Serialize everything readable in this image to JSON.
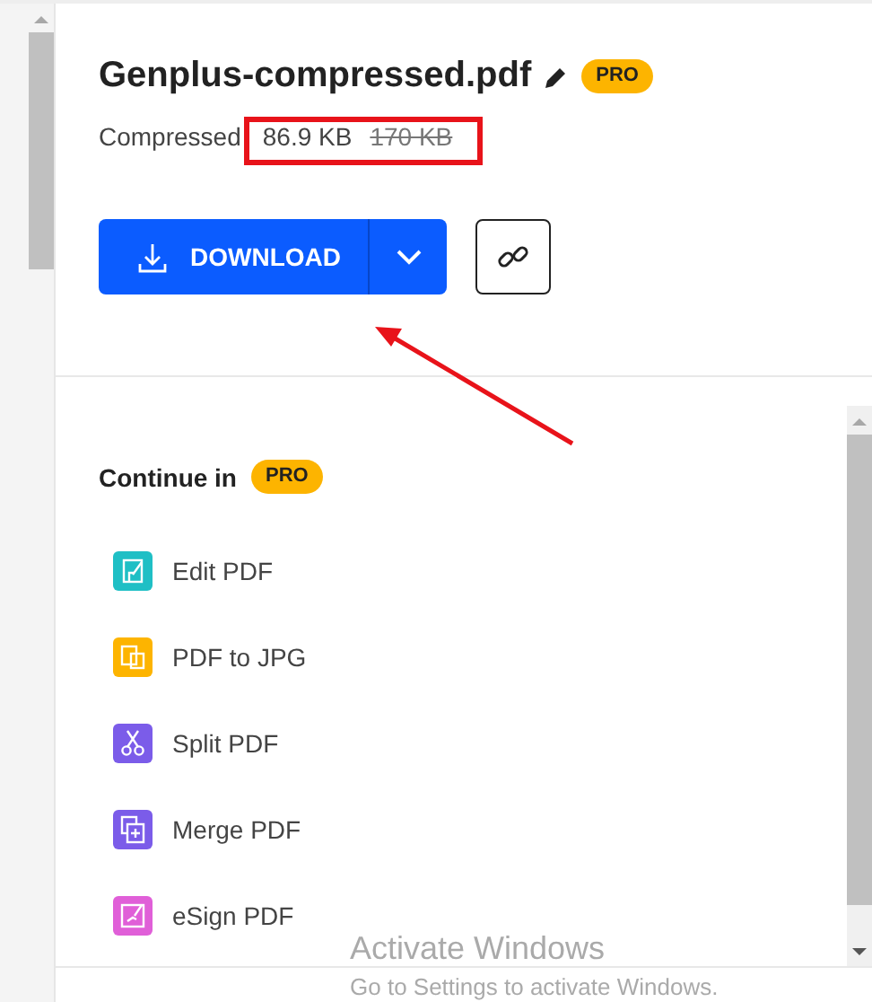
{
  "file": {
    "name": "Genplus-compressed.pdf",
    "badge": "PRO",
    "size_label": "Compressed",
    "new_size": "86.9 KB",
    "old_size": "170 KB"
  },
  "actions": {
    "download": "DOWNLOAD"
  },
  "continue_in": {
    "heading": "Continue in",
    "badge": "PRO",
    "tools": [
      {
        "label": "Edit PDF",
        "color": "#1fbfc5",
        "kind": "edit"
      },
      {
        "label": "PDF to JPG",
        "color": "#fdb400",
        "kind": "jpg"
      },
      {
        "label": "Split PDF",
        "color": "#7b5ce9",
        "kind": "split"
      },
      {
        "label": "Merge PDF",
        "color": "#7b5ce9",
        "kind": "merge"
      },
      {
        "label": "eSign PDF",
        "color": "#e05fd8",
        "kind": "sign"
      }
    ]
  },
  "system_notice": {
    "title": "Activate Windows",
    "subtitle": "Go to Settings to activate Windows."
  }
}
